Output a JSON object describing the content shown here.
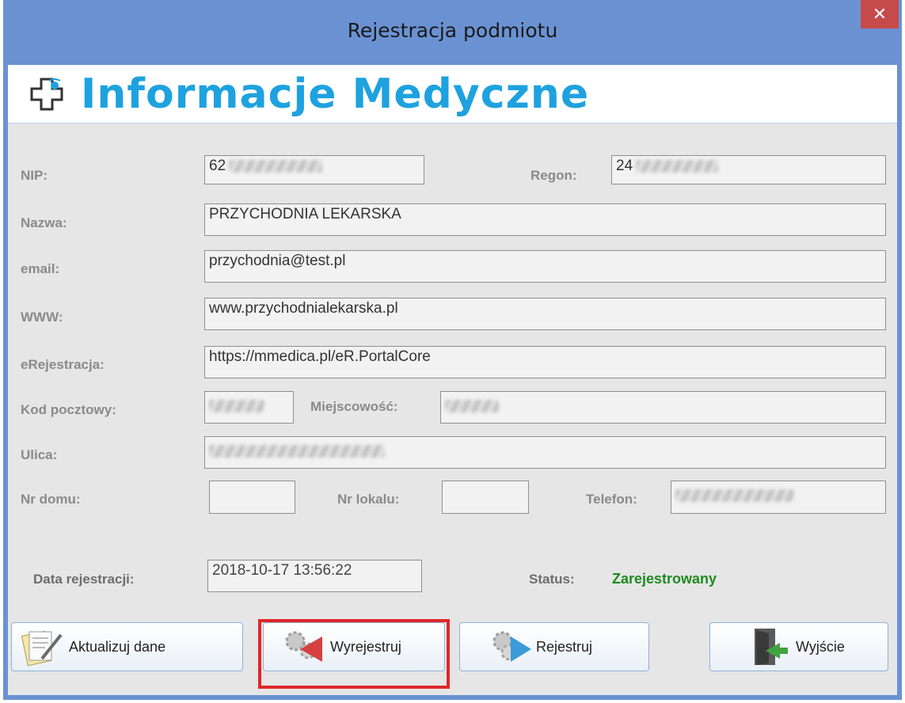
{
  "window": {
    "title": "Rejestracja podmiotu",
    "close_glyph": "✕"
  },
  "banner": {
    "title": "Informacje Medyczne",
    "icon": "medical-cross-icon"
  },
  "form": {
    "nip_label": "NIP:",
    "nip_value": "62",
    "regon_label": "Regon:",
    "regon_value": "24",
    "nazwa_label": "Nazwa:",
    "nazwa_value": "PRZYCHODNIA LEKARSKA",
    "email_label": "email:",
    "email_value": "przychodnia@test.pl",
    "www_label": "WWW:",
    "www_value": "www.przychodnialekarska.pl",
    "erej_label": "eRejestracja:",
    "erej_value": "https://mmedica.pl/eR.PortalCore",
    "kod_label": "Kod pocztowy:",
    "miejscowosc_label": "Miejscowość:",
    "ulica_label": "Ulica:",
    "nr_domu_label": "Nr domu:",
    "nr_lokalu_label": "Nr lokalu:",
    "telefon_label": "Telefon:",
    "data_label": "Data rejestracji:",
    "data_value": "2018-10-17 13:56:22",
    "status_label": "Status:",
    "status_value": "Zarejestrowany"
  },
  "buttons": {
    "aktualizuj": "Aktualizuj dane",
    "wyrejestruj": "Wyrejestruj",
    "rejestruj": "Rejestruj",
    "wyjscie": "Wyjście"
  },
  "colors": {
    "accent": "#1ea2df",
    "status": "#1f8a1f",
    "highlight": "#e0262b",
    "titlebar": "#6a92d3"
  }
}
